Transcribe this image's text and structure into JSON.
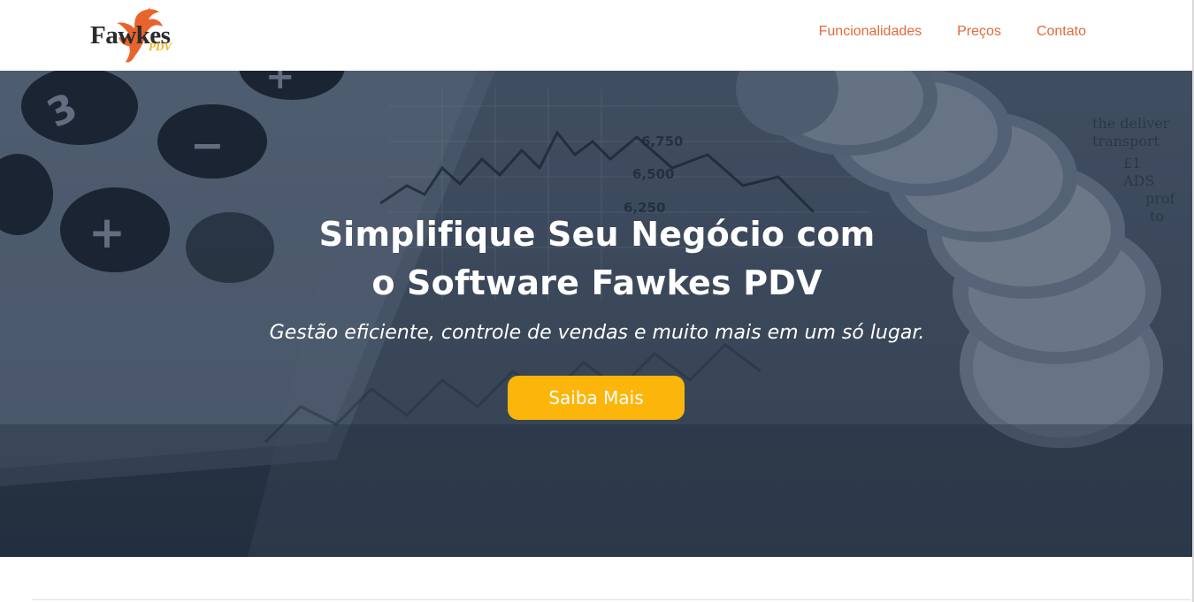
{
  "brand": {
    "name": "Fawkes",
    "sub": "PDV",
    "logo_icon": "phoenix-bird-icon",
    "colors": {
      "wordmark": "#2b2b2b",
      "bird": "#e8642c",
      "sub": "#f2b21c"
    }
  },
  "nav": {
    "items": [
      {
        "label": "Funcionalidades"
      },
      {
        "label": "Preços"
      },
      {
        "label": "Contato"
      }
    ],
    "link_color": "#e06a3b"
  },
  "hero": {
    "title_line1": "Simplifique Seu Negócio com",
    "title_line2": "o Software Fawkes PDV",
    "subtitle": "Gestão eficiente, controle de vendas e muito mais em um só lugar.",
    "cta_label": "Saiba Mais",
    "cta_color": "#fcb60b",
    "background_image": "calculator-coins-financial-chart"
  }
}
